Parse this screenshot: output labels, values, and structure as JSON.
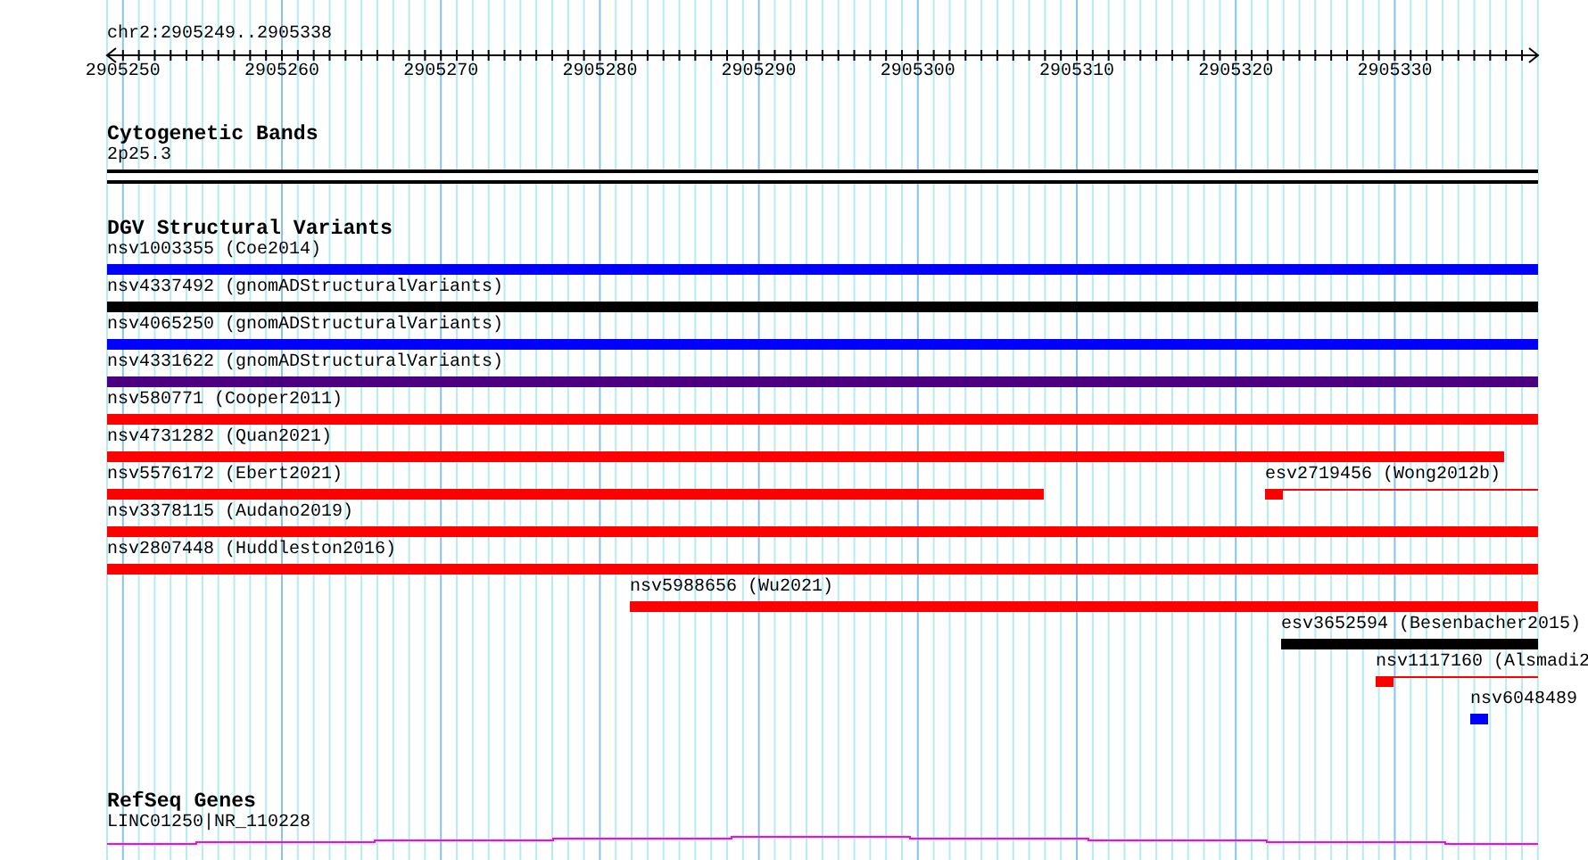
{
  "location": "chr2:2905249..2905338",
  "ruler": {
    "ticks": [
      "2905250",
      "2905260",
      "2905270",
      "2905280",
      "2905290",
      "2905300",
      "2905310",
      "2905320",
      "2905330"
    ]
  },
  "tracks": [
    {
      "kind": "cytoband",
      "title": "Cytogenetic Bands",
      "features": [
        {
          "label": "2p25.3"
        }
      ]
    },
    {
      "kind": "variants",
      "title": "DGV Structural Variants",
      "features": [
        {
          "label": "nsv1003355 (Coe2014)",
          "color": "#0000ff"
        },
        {
          "label": "nsv4337492 (gnomADStructuralVariants)",
          "color": "#000000"
        },
        {
          "label": "nsv4065250 (gnomADStructuralVariants)",
          "color": "#0000ff"
        },
        {
          "label": "nsv4331622 (gnomADStructuralVariants)",
          "color": "#4b0082"
        },
        {
          "label": "nsv580771 (Cooper2011)",
          "color": "#ff0000"
        },
        {
          "label": "nsv4731282 (Quan2021)",
          "color": "#ff0000"
        },
        {
          "label": "nsv5576172 (Ebert2021)",
          "color": "#ff0000"
        },
        {
          "label": "esv2719456 (Wong2012b)",
          "color": "#ff0000"
        },
        {
          "label": "nsv3378115 (Audano2019)",
          "color": "#ff0000"
        },
        {
          "label": "nsv2807448 (Huddleston2016)",
          "color": "#ff0000"
        },
        {
          "label": "nsv5988656 (Wu2021)",
          "color": "#ff0000"
        },
        {
          "label": "esv3652594 (Besenbacher2015)",
          "color": "#000000"
        },
        {
          "label": "nsv1117160 (Alsmadi2",
          "color": "#ff0000"
        },
        {
          "label": "nsv6048489",
          "color": "#0000ff"
        }
      ]
    },
    {
      "kind": "genes",
      "title": "RefSeq Genes",
      "features": [
        {
          "label": "LINC01250|NR_110228",
          "color": "#ff00ff"
        }
      ]
    }
  ]
}
